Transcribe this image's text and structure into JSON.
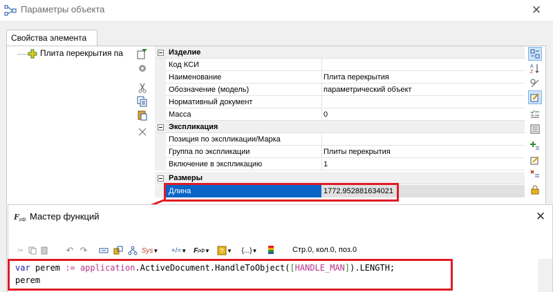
{
  "window": {
    "title": "Параметры объекта",
    "tab": "Свойства элемента"
  },
  "tree": {
    "node_label": "Плита перекрытия па"
  },
  "property_grid": {
    "categories": [
      {
        "name": "Изделие",
        "rows": [
          {
            "name": "Код КСИ",
            "value": ""
          },
          {
            "name": "Наименование",
            "value": "Плита перекрытия"
          },
          {
            "name": "Обозначение (модель)",
            "value": "параметрический объект"
          },
          {
            "name": "Нормативный документ",
            "value": ""
          },
          {
            "name": "Масса",
            "value": "0"
          }
        ]
      },
      {
        "name": "Экспликация",
        "rows": [
          {
            "name": "Позиция по экспликации/Марка",
            "value": ""
          },
          {
            "name": "Группа по экспликации",
            "value": "Плиты перекрытия"
          },
          {
            "name": "Включение в экспликацию",
            "value": "1"
          }
        ]
      },
      {
        "name": "Размеры",
        "rows": [
          {
            "name": "Длина",
            "value": "1772.952881634021",
            "selected": true
          }
        ]
      }
    ]
  },
  "wizard": {
    "title": "Мастер функций",
    "status": "Стр.0, кол.0, поз.0",
    "toolbar": {
      "sys_label": "Sys",
      "plusminus_label": "+/=",
      "braces_label": "{...}"
    },
    "code": {
      "line1": {
        "kw": "var",
        "ident": " perem ",
        "assign": ":=",
        "app": "application",
        "member": ".ActiveDocument.HandleToObject(",
        "bracket_open": "[",
        "handle": "HANDLE_MAN",
        "bracket_close": "]",
        "tail": ").LENGTH;"
      },
      "line2": "perem"
    }
  },
  "colors": {
    "highlight": "#e01b24",
    "selection": "#0a64c8",
    "keyword": "#1a1aa6",
    "identifier": "#b5338a",
    "bracket": "#1c8e2e"
  }
}
